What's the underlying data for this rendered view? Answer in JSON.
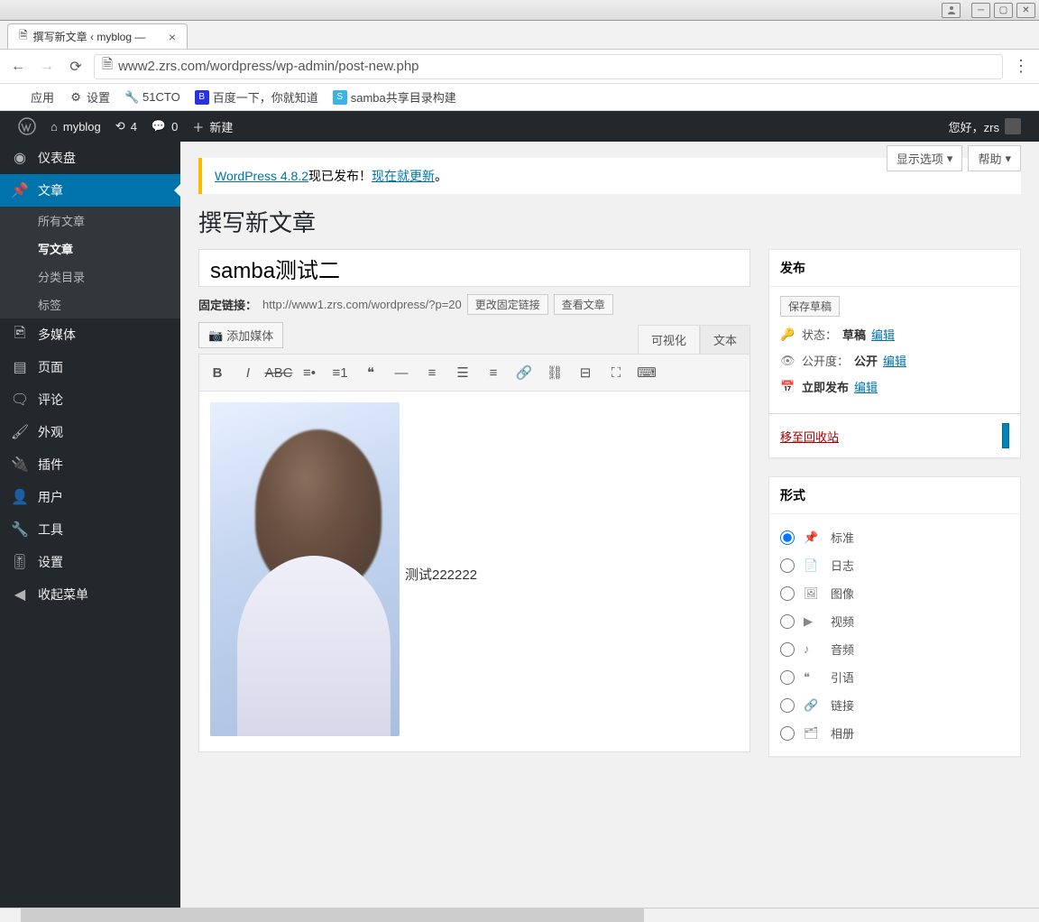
{
  "window": {
    "tab_title": "撰写新文章 ‹ myblog —"
  },
  "browser": {
    "url": "www2.zrs.com/wordpress/wp-admin/post-new.php",
    "bookmarks": {
      "apps": "应用",
      "settings": "设置",
      "cto": "51CTO",
      "baidu": "百度一下，你就知道",
      "samba": "samba共享目录构建"
    }
  },
  "adminbar": {
    "site": "myblog",
    "updates": "4",
    "comments": "0",
    "new": "新建",
    "greeting": "您好，zrs"
  },
  "sidebar": {
    "dashboard": "仪表盘",
    "posts": "文章",
    "posts_sub": {
      "all": "所有文章",
      "new": "写文章",
      "cats": "分类目录",
      "tags": "标签"
    },
    "media": "多媒体",
    "pages": "页面",
    "comments": "评论",
    "appearance": "外观",
    "plugins": "插件",
    "users": "用户",
    "tools": "工具",
    "settings": "设置",
    "collapse": "收起菜单"
  },
  "content": {
    "screen_options": "显示选项",
    "help": "帮助",
    "notice_pre": "WordPress 4.8.2",
    "notice_mid": "现已发布！",
    "notice_link": "现在就更新",
    "notice_end": "。",
    "page_title": "撰写新文章",
    "title_value": "samba测试二",
    "permalink_label": "固定链接：",
    "permalink_url": "http://www1.zrs.com/wordpress/?p=20",
    "change_permalink": "更改固定链接",
    "view_post": "查看文章",
    "add_media": "添加媒体",
    "tab_visual": "可视化",
    "tab_text": "文本",
    "body_text": "测试222222"
  },
  "publish": {
    "title": "发布",
    "save_draft": "保存草稿",
    "status_label": "状态：",
    "status_value": "草稿",
    "visibility_label": "公开度：",
    "visibility_value": "公开",
    "publish_label": "立即发布",
    "edit": "编辑",
    "trash": "移至回收站"
  },
  "formats": {
    "title": "形式",
    "items": [
      {
        "label": "标准",
        "checked": true
      },
      {
        "label": "日志",
        "checked": false
      },
      {
        "label": "图像",
        "checked": false
      },
      {
        "label": "视频",
        "checked": false
      },
      {
        "label": "音频",
        "checked": false
      },
      {
        "label": "引语",
        "checked": false
      },
      {
        "label": "链接",
        "checked": false
      },
      {
        "label": "相册",
        "checked": false
      }
    ]
  }
}
